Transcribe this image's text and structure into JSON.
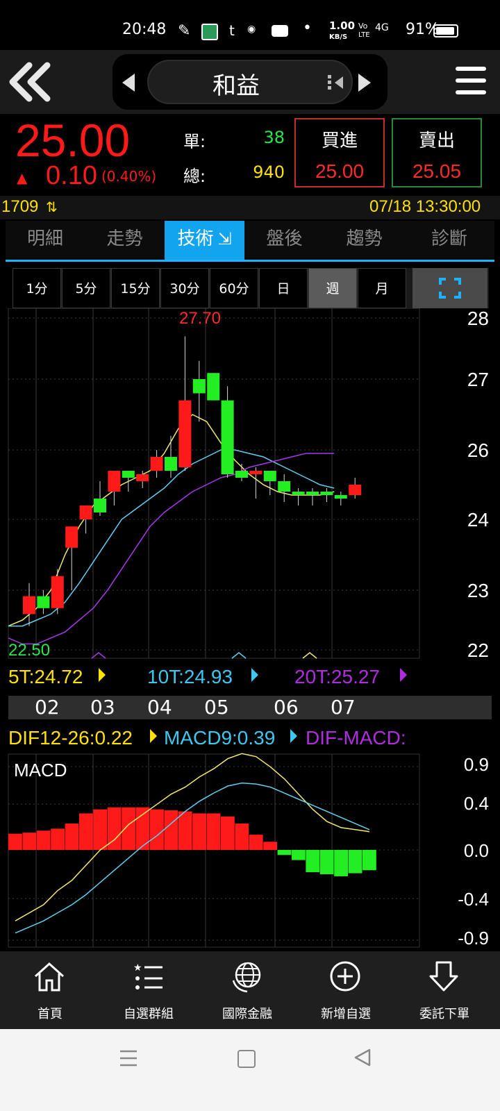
{
  "status_bar": {
    "time": "20:48",
    "net_speed_top": "1.00",
    "net_speed_bottom": "KB/S",
    "volte_top": "Vo",
    "volte_bottom": "LTE",
    "signal": "4G",
    "battery": "91%"
  },
  "header": {
    "stock_name": "和益"
  },
  "quote": {
    "price": "25.00",
    "change_arrow": "▲",
    "change": "0.10",
    "change_pct": "(0.40%)",
    "single_label": "單:",
    "single_value": "38",
    "total_label": "總:",
    "total_value": "940",
    "buy_label": "買進",
    "buy_price": "25.00",
    "sell_label": "賣出",
    "sell_price": "25.05"
  },
  "info": {
    "code": "1709",
    "datetime": "07/18 13:30:00"
  },
  "tabs": [
    {
      "label": "明細"
    },
    {
      "label": "走勢"
    },
    {
      "label": "技術"
    },
    {
      "label": "盤後"
    },
    {
      "label": "趨勢"
    },
    {
      "label": "診斷"
    }
  ],
  "periods": [
    {
      "label": "1分"
    },
    {
      "label": "5分"
    },
    {
      "label": "15分"
    },
    {
      "label": "30分"
    },
    {
      "label": "60分"
    },
    {
      "label": "日"
    },
    {
      "label": "週"
    },
    {
      "label": "月"
    }
  ],
  "price_chart": {
    "high_label": "27.70",
    "low_label": "22.50",
    "y_ticks": [
      "28",
      "27",
      "26",
      "24",
      "23",
      "22"
    ],
    "ma5": "5T:24.72",
    "ma10": "10T:24.93",
    "ma20": "20T:25.27",
    "month_labels": [
      "02",
      "03",
      "04",
      "05",
      "06",
      "07"
    ]
  },
  "macd_chart": {
    "legend_dif": "DIF12-26:0.22",
    "legend_macd": "MACD9:0.39",
    "legend_osc": "DIF-MACD:",
    "title": "MACD",
    "y_ticks": [
      "0.9",
      "0.4",
      "0.0",
      "-0.4",
      "-0.9"
    ]
  },
  "bottom_nav": [
    {
      "label": "首頁"
    },
    {
      "label": "自選群組"
    },
    {
      "label": "國際金融"
    },
    {
      "label": "新增自選"
    },
    {
      "label": "委託下單"
    }
  ],
  "chart_data": [
    {
      "type": "candlestick",
      "y_ticks_printed": [
        "28",
        "27",
        "26",
        "24",
        "23",
        "22"
      ],
      "x_labels": [
        "02",
        "03",
        "04",
        "05",
        "06",
        "07"
      ],
      "candles": [
        {
          "o": 22.6,
          "h": 23.1,
          "l": 22.4,
          "c": 22.9
        },
        {
          "o": 22.9,
          "h": 23.0,
          "l": 22.6,
          "c": 22.7
        },
        {
          "o": 22.7,
          "h": 23.3,
          "l": 22.6,
          "c": 23.2
        },
        {
          "o": 23.6,
          "h": 23.8,
          "l": 23.0,
          "c": 23.9
        },
        {
          "o": 24.0,
          "h": 24.3,
          "l": 23.8,
          "c": 24.4
        },
        {
          "o": 24.6,
          "h": 25.1,
          "l": 24.1,
          "c": 24.2
        },
        {
          "o": 24.8,
          "h": 25.1,
          "l": 24.4,
          "c": 25.4
        },
        {
          "o": 25.4,
          "h": 25.3,
          "l": 24.8,
          "c": 25.2
        },
        {
          "o": 25.1,
          "h": 25.4,
          "l": 24.9,
          "c": 25.3
        },
        {
          "o": 25.4,
          "h": 26.0,
          "l": 25.2,
          "c": 25.8
        },
        {
          "o": 25.8,
          "h": 26.2,
          "l": 25.2,
          "c": 25.4
        },
        {
          "o": 25.5,
          "h": 27.7,
          "l": 25.4,
          "c": 26.7
        },
        {
          "o": 27.0,
          "h": 27.3,
          "l": 26.4,
          "c": 26.8
        },
        {
          "o": 27.1,
          "h": 27.1,
          "l": 26.7,
          "c": 26.7
        },
        {
          "o": 26.7,
          "h": 26.9,
          "l": 25.2,
          "c": 25.3
        },
        {
          "o": 25.4,
          "h": 25.6,
          "l": 25.1,
          "c": 25.2
        },
        {
          "o": 25.3,
          "h": 25.5,
          "l": 24.6,
          "c": 25.4
        },
        {
          "o": 25.4,
          "h": 25.4,
          "l": 24.7,
          "c": 25.1
        },
        {
          "o": 25.1,
          "h": 25.3,
          "l": 24.5,
          "c": 24.8
        },
        {
          "o": 24.8,
          "h": 24.9,
          "l": 24.4,
          "c": 24.7
        },
        {
          "o": 24.8,
          "h": 24.9,
          "l": 24.4,
          "c": 24.7
        },
        {
          "o": 24.8,
          "h": 24.9,
          "l": 24.5,
          "c": 24.7
        },
        {
          "o": 24.7,
          "h": 24.8,
          "l": 24.4,
          "c": 24.6
        },
        {
          "o": 24.7,
          "h": 25.2,
          "l": 24.6,
          "c": 25.0
        }
      ],
      "ma5": [
        22.4,
        22.5,
        22.7,
        23.0,
        23.5,
        23.9,
        24.4,
        24.7,
        25.0,
        25.2,
        25.4,
        25.9,
        26.3,
        26.5,
        26.4,
        26.1,
        25.7,
        25.3,
        25.0,
        24.8,
        24.7,
        24.7,
        24.7,
        24.8
      ],
      "ma10": [
        22.4,
        22.4,
        22.5,
        22.6,
        22.8,
        23.1,
        23.4,
        23.7,
        24.0,
        24.3,
        24.6,
        24.9,
        25.3,
        25.6,
        25.8,
        26.0,
        26.0,
        25.9,
        25.8,
        25.6,
        25.4,
        25.2,
        25.0,
        24.9
      ],
      "ma20": [
        22.2,
        22.1,
        22.1,
        22.2,
        22.3,
        22.5,
        22.7,
        23.0,
        23.3,
        23.6,
        23.9,
        24.2,
        24.5,
        24.8,
        25.0,
        25.2,
        25.3,
        25.5,
        25.6,
        25.7,
        25.8,
        25.9,
        25.9,
        25.9
      ]
    },
    {
      "type": "bar",
      "name": "MACD",
      "y_ticks_printed": [
        "0.9",
        "0.4",
        "0.0",
        "-0.4",
        "-0.9"
      ],
      "osc": [
        0.16,
        0.17,
        0.19,
        0.21,
        0.26,
        0.36,
        0.4,
        0.42,
        0.42,
        0.42,
        0.4,
        0.39,
        0.38,
        0.36,
        0.36,
        0.33,
        0.26,
        0.15,
        0.08,
        -0.05,
        -0.1,
        -0.22,
        -0.24,
        -0.26,
        -0.23,
        -0.2
      ],
      "dif": [
        -0.7,
        -0.62,
        -0.54,
        -0.4,
        -0.3,
        -0.15,
        0.0,
        0.1,
        0.25,
        0.35,
        0.45,
        0.55,
        0.62,
        0.72,
        0.8,
        0.9,
        0.95,
        0.92,
        0.82,
        0.7,
        0.55,
        0.4,
        0.28,
        0.22,
        0.2,
        0.18
      ],
      "macd": [
        -0.82,
        -0.76,
        -0.7,
        -0.62,
        -0.54,
        -0.44,
        -0.32,
        -0.2,
        -0.08,
        0.04,
        0.14,
        0.26,
        0.38,
        0.48,
        0.56,
        0.63,
        0.66,
        0.65,
        0.62,
        0.56,
        0.5,
        0.44,
        0.38,
        0.32,
        0.26,
        0.2
      ]
    }
  ]
}
